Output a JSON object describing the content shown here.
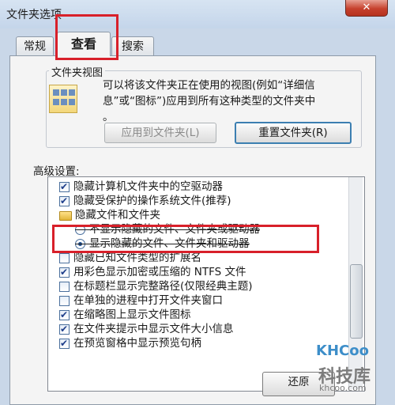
{
  "window": {
    "title": "文件夹选项",
    "close_glyph": "✕"
  },
  "tabs": [
    {
      "label": "常规",
      "active": false
    },
    {
      "label": "查看",
      "active": true
    },
    {
      "label": "搜索",
      "active": false
    }
  ],
  "folder_views": {
    "legend": "文件夹视图",
    "description_lines": [
      "可以将该文件夹正在使用的视图(例如“详细信",
      "息”或“图标”)应用到所有这种类型的文件夹中",
      "。"
    ],
    "apply_button": "应用到文件夹(L)",
    "reset_button": "重置文件夹(R)"
  },
  "advanced": {
    "label": "高级设置:",
    "items": [
      {
        "kind": "checkbox",
        "checked": true,
        "label": "隐藏计算机文件夹中的空驱动器"
      },
      {
        "kind": "checkbox",
        "checked": true,
        "label": "隐藏受保护的操作系统文件(推荐)"
      },
      {
        "kind": "folder",
        "label": "隐藏文件和文件夹"
      },
      {
        "kind": "radio",
        "selected": false,
        "label": "不显示隐藏的文件、文件夹或驱动器"
      },
      {
        "kind": "radio",
        "selected": true,
        "label": "显示隐藏的文件、文件夹和驱动器"
      },
      {
        "kind": "checkbox",
        "checked": false,
        "label": "隐藏已知文件类型的扩展名"
      },
      {
        "kind": "checkbox",
        "checked": true,
        "label": "用彩色显示加密或压缩的 NTFS 文件"
      },
      {
        "kind": "checkbox",
        "checked": false,
        "label": "在标题栏显示完整路径(仅限经典主题)"
      },
      {
        "kind": "checkbox",
        "checked": false,
        "label": "在单独的进程中打开文件夹窗口"
      },
      {
        "kind": "checkbox",
        "checked": true,
        "label": "在缩略图上显示文件图标"
      },
      {
        "kind": "checkbox",
        "checked": true,
        "label": "在文件夹提示中显示文件大小信息"
      },
      {
        "kind": "checkbox",
        "checked": true,
        "label": "在预览窗格中显示预览句柄"
      }
    ]
  },
  "restore_button": "还原",
  "watermark": {
    "brand": "KHCoo",
    "name": "科技库",
    "url": "khcoo.com"
  }
}
